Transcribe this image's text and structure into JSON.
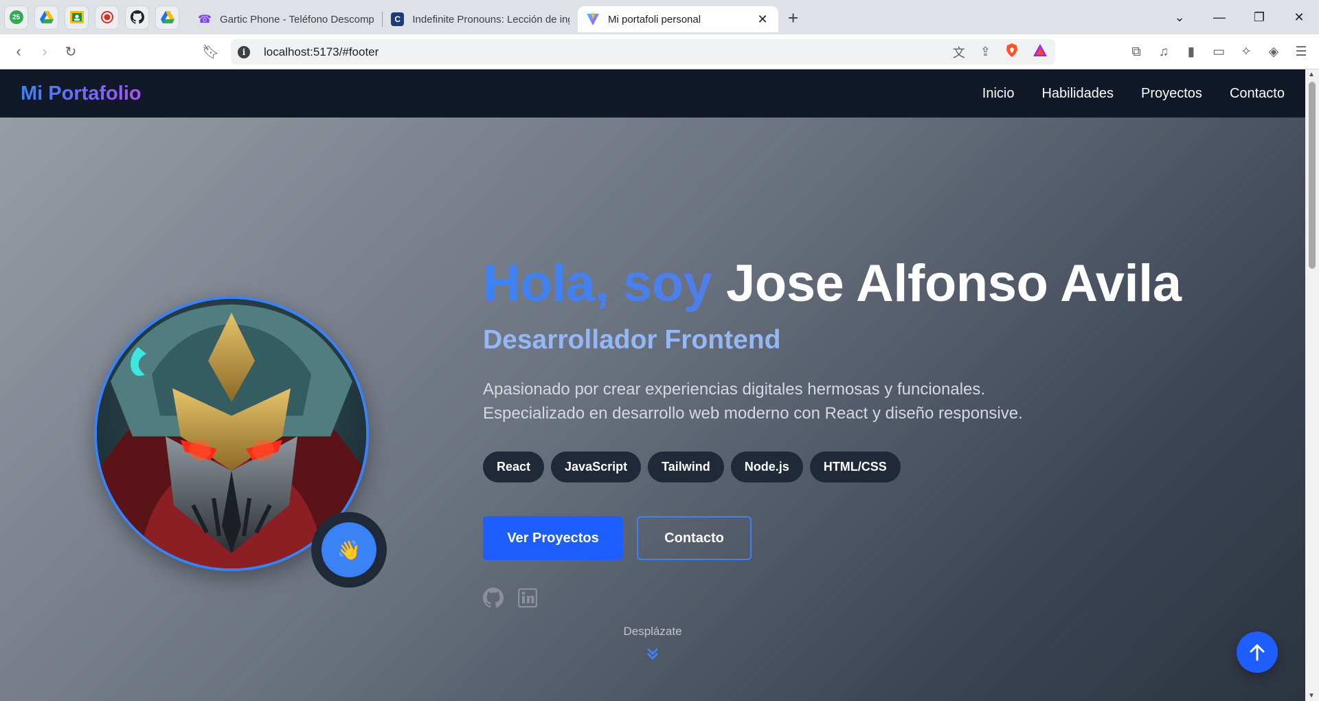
{
  "browser": {
    "pinned_tabs": [
      "calendar-icon",
      "drive-icon",
      "classroom-icon",
      "record-icon",
      "github-icon",
      "drive-icon"
    ],
    "tabs": [
      {
        "title": "Gartic Phone - Teléfono Descompuesto",
        "icon": "phone-icon"
      },
      {
        "title": "Indefinite Pronouns: Lección de inglés",
        "icon": "c-logo-icon"
      },
      {
        "title": "Mi portafoli personal",
        "icon": "vite-icon",
        "active": true
      }
    ],
    "url": "localhost:5173/#footer",
    "pin_badge": "25"
  },
  "site": {
    "brand": "Mi Portafolio",
    "nav": [
      "Inicio",
      "Habilidades",
      "Proyectos",
      "Contacto"
    ]
  },
  "hero": {
    "greeting": "Hola, soy",
    "name": "Jose Alfonso Avila",
    "role": "Desarrollador Frontend",
    "description_line1": "Apasionado por crear experiencias digitales hermosas y funcionales.",
    "description_line2": "Especializado en desarrollo web moderno con React y diseño responsive.",
    "skills": [
      "React",
      "JavaScript",
      "Tailwind",
      "Node.js",
      "HTML/CSS"
    ],
    "primary_button": "Ver Proyectos",
    "secondary_button": "Contacto",
    "scroll_hint": "Desplázate",
    "wave_emoji": "👋"
  },
  "colors": {
    "accent": "#3b82f6",
    "primary_button": "#1e5eff",
    "nav_bg": "#111827",
    "chip_bg": "#1f2937"
  }
}
